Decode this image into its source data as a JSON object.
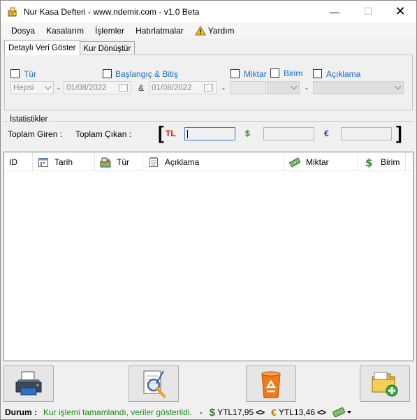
{
  "window": {
    "title": "Nur Kasa Defteri  - www.ndemir.com - v1.0 Beta",
    "minimize_glyph": "—",
    "maximize_glyph": "☐",
    "close_glyph": "✕"
  },
  "menu": {
    "items": [
      "Dosya",
      "Kasalarım",
      "İşlemler",
      "Hatırlatmalar"
    ],
    "help_label": "Yardım"
  },
  "tabs": [
    "Detaylı Veri Göster",
    "Kur Dönüştür"
  ],
  "filters": {
    "tur_label": "Tür",
    "tur_value": "Hepsi",
    "dash": "-",
    "date_range_label": "Başlangıç & Bitiş",
    "start_date": "01/08/2022",
    "amp": "&",
    "end_date": "01/08/2022",
    "miktar_label": "Miktar",
    "birim_label": "Birim",
    "aciklama_label": "Açıklama"
  },
  "stats": {
    "title": "İstatistikler",
    "toplam_giren": "Toplam Giren :",
    "toplam_cikan": "Toplam Çıkan :",
    "bracket_open": "[",
    "bracket_close": "]",
    "tl": "TL",
    "usd": "$",
    "eur": "€",
    "colors": {
      "tl": "#d01010",
      "usd": "#1f8a1f",
      "eur": "#1030c0"
    }
  },
  "grid": {
    "columns": [
      "ID",
      "Tarih",
      "Tür",
      "Açıklama",
      "Miktar",
      "Birim"
    ]
  },
  "buttons": {
    "icons": [
      "printer-icon",
      "report-search-icon",
      "recycle-bin-icon",
      "add-folder-icon"
    ]
  },
  "status": {
    "key": "Durum :",
    "message": "Kur işlemi tamamlandı, veriler gösterildi.",
    "dash": "-",
    "usd_symbol": "$",
    "usd_rate": "YTL17,95",
    "eur_symbol": "€",
    "eur_rate": "YTL13,46",
    "chevrons": "<>",
    "message_color": "#1b8a1b"
  }
}
